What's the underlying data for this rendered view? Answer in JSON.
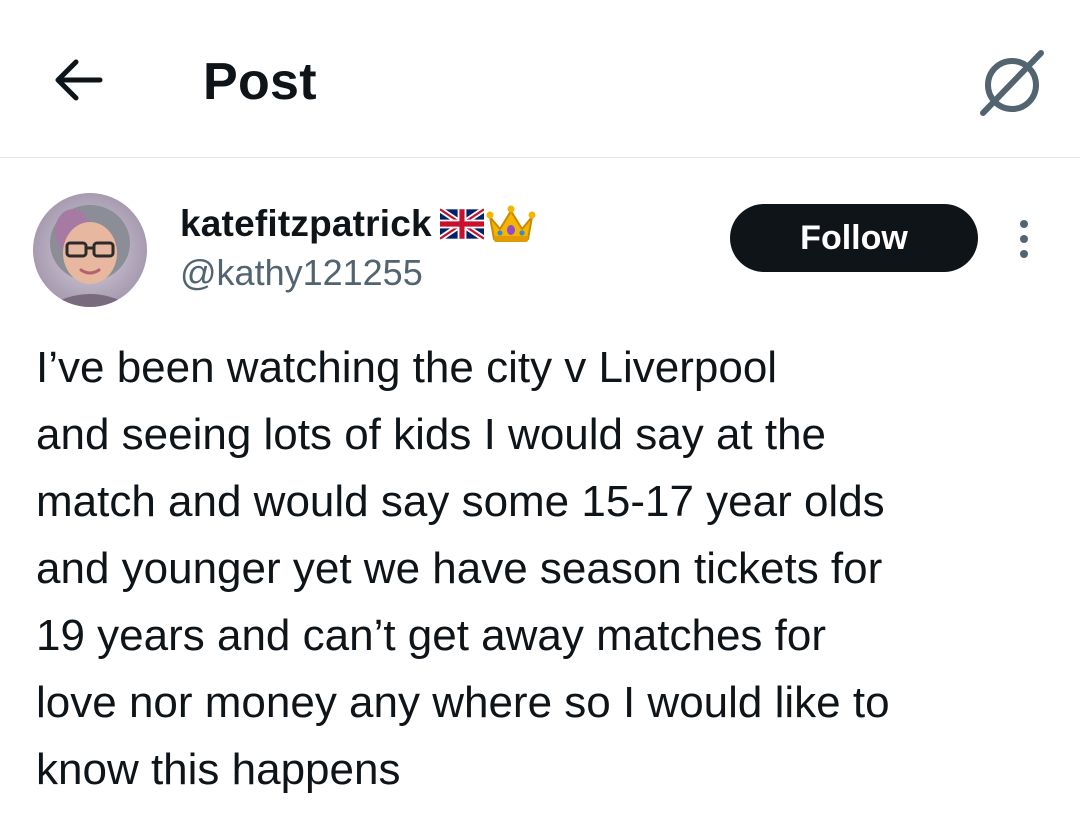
{
  "header": {
    "back_icon": "arrow-left-icon",
    "title": "Post",
    "grok_icon": "grok-icon"
  },
  "author": {
    "display_name": "katefitzpatrick",
    "handle": "@kathy121255",
    "badges": [
      "uk-flag-emoji",
      "crown-emoji"
    ],
    "avatar": "avatar"
  },
  "actions": {
    "follow_label": "Follow",
    "more_icon": "more-vertical-icon"
  },
  "post": {
    "text": "I’ve been watching the city v Liverpool\nand seeing lots of kids  I would say at the\nmatch and would say some 15-17 year olds\nand younger yet we have season tickets for\n19 years and can’t get away matches for\nlove nor money any where so I would like to\nknow this happens"
  },
  "colors": {
    "text": "#0f1419",
    "secondary": "#536471",
    "follow_bg": "#0f1419",
    "divider": "#e6e6e6"
  }
}
